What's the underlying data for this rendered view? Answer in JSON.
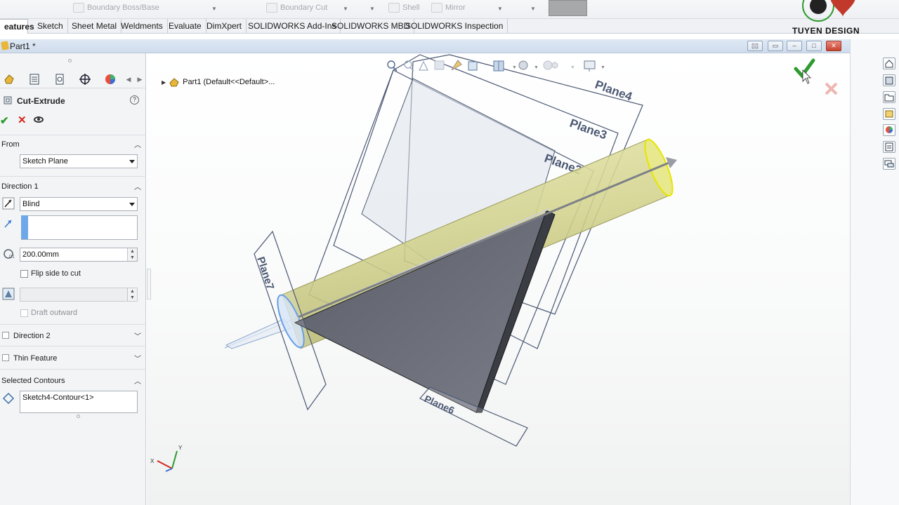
{
  "toolbar": {
    "items": [
      {
        "label": "Boundary Boss/Base"
      },
      {
        "label": "Boundary Cut"
      },
      {
        "label": "Shell"
      },
      {
        "label": "Mirror"
      }
    ]
  },
  "tabs": [
    {
      "label": "eatures",
      "active": true
    },
    {
      "label": "Sketch"
    },
    {
      "label": "Sheet Metal"
    },
    {
      "label": "Weldments"
    },
    {
      "label": "Evaluate"
    },
    {
      "label": "DimXpert"
    },
    {
      "label": "SOLIDWORKS Add-Ins"
    },
    {
      "label": "SOLIDWORKS MBD"
    },
    {
      "label": "SOLIDWORKS Inspection"
    }
  ],
  "logo": {
    "text": "TUYEN  DESIGN",
    "color": "#c0392b"
  },
  "document": {
    "title": "Part1 *"
  },
  "tree_path": "Part1  (Default<<Default>...",
  "property_manager": {
    "title": "Cut-Extrude",
    "from": {
      "label": "From",
      "value": "Sketch Plane"
    },
    "direction1": {
      "label": "Direction 1",
      "end_condition": "Blind",
      "depth": "200.00mm",
      "flip_side": "Flip side to cut",
      "draft_outward": "Draft outward"
    },
    "direction2": {
      "label": "Direction 2"
    },
    "thin_feature": {
      "label": "Thin Feature"
    },
    "selected_contours": {
      "label": "Selected Contours",
      "value": "Sketch4-Contour<1>"
    }
  },
  "planes": {
    "p2": "Plane2",
    "p3": "Plane3",
    "p4": "Plane4",
    "p6": "Plane6",
    "p7": "Plane7"
  },
  "triad": {
    "x": "X",
    "y": "Y"
  },
  "colors": {
    "accent_green": "#2e9b2e",
    "cancel_red": "#d2291e",
    "cylinder": "#d9d99a",
    "triangle": "#6b6e78",
    "selection_blue": "#6fa8e8"
  }
}
